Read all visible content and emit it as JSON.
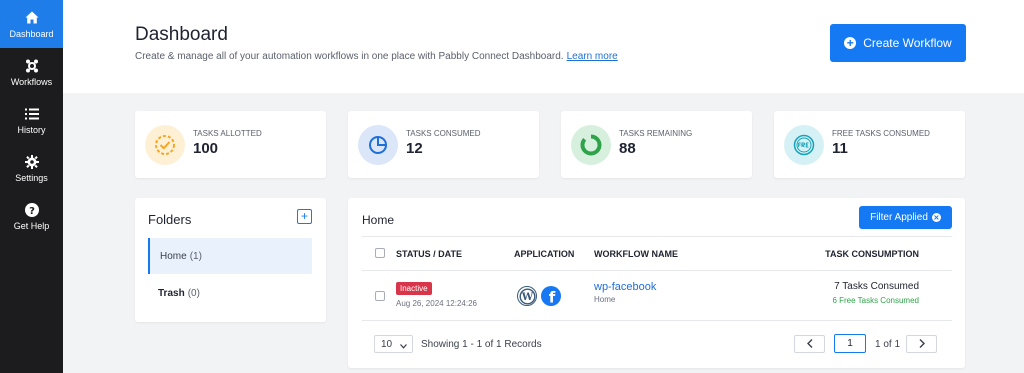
{
  "sidebar": {
    "items": [
      {
        "label": "Dashboard",
        "icon": "home-icon"
      },
      {
        "label": "Workflows",
        "icon": "workflows-icon"
      },
      {
        "label": "History",
        "icon": "history-icon"
      },
      {
        "label": "Settings",
        "icon": "gear-icon"
      },
      {
        "label": "Get Help",
        "icon": "help-icon"
      }
    ]
  },
  "header": {
    "title": "Dashboard",
    "subtitle": "Create & manage all of your automation workflows in one place with Pabbly Connect Dashboard.",
    "learn_more": "Learn more",
    "create_button": "Create Workflow"
  },
  "stats": [
    {
      "label": "TASKS ALLOTTED",
      "value": "100",
      "color": "#f5a623"
    },
    {
      "label": "TASKS CONSUMED",
      "value": "12",
      "color": "#1e6fd9"
    },
    {
      "label": "TASKS REMAINING",
      "value": "88",
      "color": "#2fa34a"
    },
    {
      "label": "FREE TASKS CONSUMED",
      "value": "11",
      "color": "#17a2b8"
    }
  ],
  "folders": {
    "title": "Folders",
    "items": [
      {
        "name": "Home",
        "count": "(1)"
      },
      {
        "name": "Trash",
        "count": "(0)"
      }
    ]
  },
  "workflows": {
    "title": "Home",
    "filter_button": "Filter Applied",
    "columns": [
      "STATUS / DATE",
      "APPLICATION",
      "WORKFLOW NAME",
      "TASK CONSUMPTION"
    ],
    "rows": [
      {
        "status": "Inactive",
        "date": "Aug 26, 2024 12:24:26",
        "apps": [
          "wordpress-icon",
          "facebook-icon"
        ],
        "name": "wp-facebook",
        "folder": "Home",
        "tasks": "7 Tasks Consumed",
        "free_tasks": "6 Free Tasks Consumed"
      }
    ],
    "pagination": {
      "per_page": "10",
      "info": "Showing 1 - 1 of 1 Records",
      "current_page": "1",
      "of_pages": "1 of 1"
    }
  }
}
